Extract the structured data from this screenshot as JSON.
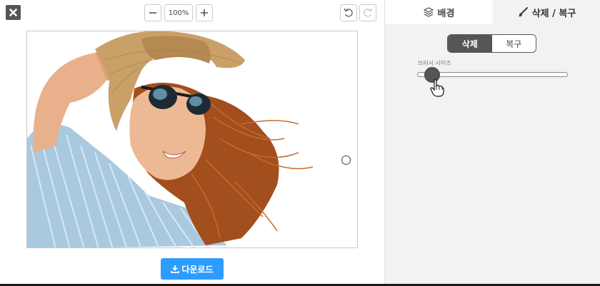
{
  "toolbar": {
    "zoom_value": "100%",
    "zoom_out_icon": "minus-icon",
    "zoom_in_icon": "plus-icon",
    "undo_icon": "undo-icon",
    "redo_icon": "redo-icon",
    "close_icon": "close-icon"
  },
  "download": {
    "label": "다운로드",
    "icon": "download-icon"
  },
  "tabs": [
    {
      "label": "배경",
      "icon": "layers-icon",
      "active": false
    },
    {
      "label": "삭제 / 복구",
      "icon": "brush-icon",
      "active": true
    }
  ],
  "mode_toggle": {
    "options": [
      "삭제",
      "복구"
    ],
    "selected": "삭제"
  },
  "brush_size": {
    "label": "브러시 사이즈",
    "value_fraction": 0.1
  },
  "colors": {
    "accent": "#2e9bff",
    "dark": "#555555",
    "panel": "#f2f2f2"
  }
}
